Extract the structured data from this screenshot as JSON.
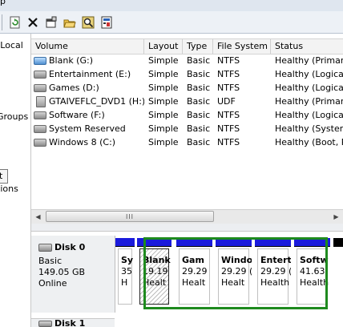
{
  "window": {
    "title_fragment": "p"
  },
  "toolbar": {
    "icons": [
      "back-icon",
      "forward-icon",
      "properties-icon",
      "refresh-icon",
      "delete-icon",
      "settings-icon",
      "open-icon",
      "search-icon",
      "help-icon"
    ]
  },
  "left_pane": {
    "items": [
      "(Local",
      "Groups",
      "t",
      "tions"
    ]
  },
  "table": {
    "columns": [
      "Volume",
      "Layout",
      "Type",
      "File System",
      "Status"
    ],
    "rows": [
      {
        "icon": "blue-drive-icon",
        "volume": "Blank (G:)",
        "layout": "Simple",
        "type": "Basic",
        "fs": "NTFS",
        "status": "Healthy (Primar"
      },
      {
        "icon": "drive-icon",
        "volume": "Entertainment (E:)",
        "layout": "Simple",
        "type": "Basic",
        "fs": "NTFS",
        "status": "Healthy (Logica"
      },
      {
        "icon": "drive-icon",
        "volume": "Games (D:)",
        "layout": "Simple",
        "type": "Basic",
        "fs": "NTFS",
        "status": "Healthy (Logica"
      },
      {
        "icon": "cd-drive-icon",
        "volume": "GTAIVEFLC_DVD1 (H:)",
        "layout": "Simple",
        "type": "Basic",
        "fs": "UDF",
        "status": "Healthy (Primar"
      },
      {
        "icon": "drive-icon",
        "volume": "Software (F:)",
        "layout": "Simple",
        "type": "Basic",
        "fs": "NTFS",
        "status": "Healthy (Logica"
      },
      {
        "icon": "drive-icon",
        "volume": "System Reserved",
        "layout": "Simple",
        "type": "Basic",
        "fs": "NTFS",
        "status": "Healthy (System"
      },
      {
        "icon": "drive-icon",
        "volume": "Windows 8 (C:)",
        "layout": "Simple",
        "type": "Basic",
        "fs": "NTFS",
        "status": "Healthy (Boot, P"
      }
    ]
  },
  "scrollbar": {
    "thumb_grip": "III"
  },
  "disk0": {
    "name": "Disk 0",
    "type": "Basic",
    "size": "149.05 GB",
    "state": "Online",
    "partitions": [
      {
        "name": "Sy",
        "size": "35",
        "status": "H"
      },
      {
        "name": "Blank",
        "size": "19.19",
        "status": "Healt"
      },
      {
        "name": "Gam",
        "size": "29.29",
        "status": "Healt"
      },
      {
        "name": "Windo",
        "size": "29.29 (",
        "status": "Healt"
      },
      {
        "name": "Entert",
        "size": "29.29 (",
        "status": "Health"
      },
      {
        "name": "Softw",
        "size": "41.63",
        "status": "Health"
      }
    ]
  },
  "disk1": {
    "name": "Disk 1"
  },
  "colors": {
    "primary_bar": "#1a1adc",
    "logical_frame": "#1e8a1e",
    "unallocated_bar": "#25306b"
  }
}
